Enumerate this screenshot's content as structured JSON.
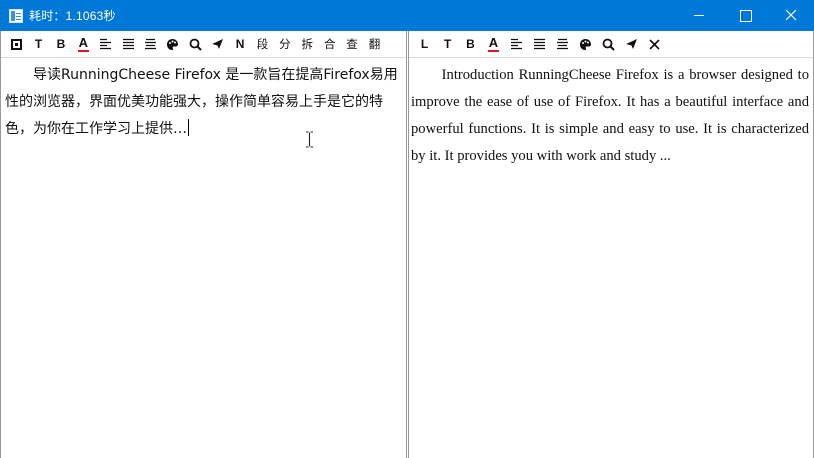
{
  "window": {
    "title": "耗时：1.1063秒",
    "icon": "notepad-icon"
  },
  "left_pane": {
    "toolbar": [
      {
        "name": "frame-icon",
        "label": ""
      },
      {
        "name": "text-icon",
        "label": "T"
      },
      {
        "name": "bold-icon",
        "label": "B"
      },
      {
        "name": "font-color-icon",
        "label": "A"
      },
      {
        "name": "align-left-icon",
        "label": ""
      },
      {
        "name": "align-center-icon",
        "label": ""
      },
      {
        "name": "align-justify-icon",
        "label": ""
      },
      {
        "name": "palette-icon",
        "label": ""
      },
      {
        "name": "search-icon",
        "label": ""
      },
      {
        "name": "send-icon",
        "label": ""
      },
      {
        "name": "n-button",
        "label": "N"
      },
      {
        "name": "paragraph-button",
        "label": "段"
      },
      {
        "name": "split-button",
        "label": "分"
      },
      {
        "name": "break-button",
        "label": "拆"
      },
      {
        "name": "merge-button",
        "label": "合"
      },
      {
        "name": "lookup-button",
        "label": "查"
      },
      {
        "name": "translate-button",
        "label": "翻"
      }
    ],
    "text": "导读RunningCheese Firefox 是一款旨在提高Firefox易用性的浏览器，界面优美功能强大，操作简单容易上手是它的特色，为你在工作学习上提供…"
  },
  "right_pane": {
    "toolbar": [
      {
        "name": "l-button",
        "label": "L"
      },
      {
        "name": "text-icon",
        "label": "T"
      },
      {
        "name": "bold-icon",
        "label": "B"
      },
      {
        "name": "font-color-icon",
        "label": "A"
      },
      {
        "name": "align-left-icon",
        "label": ""
      },
      {
        "name": "align-center-icon",
        "label": ""
      },
      {
        "name": "align-justify-icon",
        "label": ""
      },
      {
        "name": "palette-icon",
        "label": ""
      },
      {
        "name": "search-icon",
        "label": ""
      },
      {
        "name": "send-icon",
        "label": ""
      },
      {
        "name": "close-icon",
        "label": ""
      }
    ],
    "text": "Introduction RunningCheese Firefox is a browser designed to improve the ease of use of Firefox. It has a beautiful interface and powerful functions. It is simple and easy to use. It is characterized by it. It provides you with work and study ..."
  },
  "colors": {
    "titlebar": "#0078d7",
    "font_color_bar": "#e81123"
  }
}
